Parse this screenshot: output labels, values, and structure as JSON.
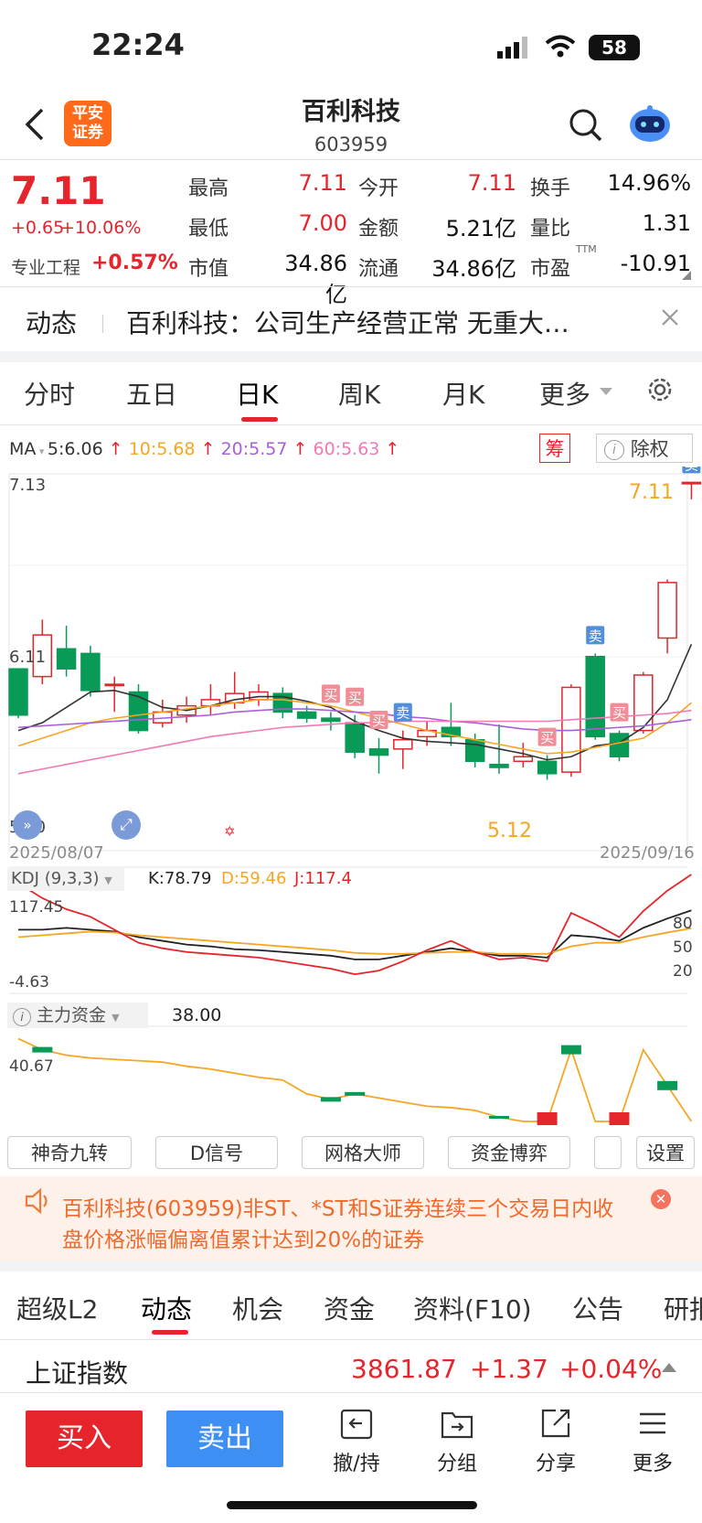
{
  "status_bar": {
    "time": "22:24",
    "battery": "58"
  },
  "header": {
    "broker_logo": "平安\n证券",
    "name": "百利科技",
    "code": "603959"
  },
  "quote": {
    "price": "7.11",
    "change": "+0.65",
    "change_pct": "+10.06%",
    "sector": "专业工程",
    "sector_pct": "+0.57%",
    "rows": [
      [
        {
          "label": "最高",
          "value": "7.11",
          "color": "red"
        },
        {
          "label": "今开",
          "value": "7.11",
          "color": "red"
        },
        {
          "label": "换手",
          "value": "14.96%",
          "color": "black"
        }
      ],
      [
        {
          "label": "最低",
          "value": "7.00",
          "color": "red"
        },
        {
          "label": "金额",
          "value": "5.21亿",
          "color": "black"
        },
        {
          "label": "量比",
          "value": "1.31",
          "color": "black"
        }
      ],
      [
        {
          "label": "市值",
          "value": "34.86亿",
          "color": "black"
        },
        {
          "label": "流通",
          "value": "34.86亿",
          "color": "black"
        },
        {
          "label": "市盈",
          "value": "-10.91",
          "color": "black"
        }
      ]
    ],
    "ttm": "TTM"
  },
  "news": {
    "tag": "动态",
    "text": "百利科技：公司生产经营正常 无重大…"
  },
  "period_tabs": [
    "分时",
    "五日",
    "日K",
    "周K",
    "月K",
    "更多"
  ],
  "active_period": "日K",
  "ma_legend": {
    "label": "MA",
    "ma5": "5:6.06",
    "ma10": "10:5.68",
    "ma20": "20:5.57",
    "ma60": "60:5.63",
    "chip": "筹",
    "adjust": "除权"
  },
  "chart_data": [
    {
      "type": "candlestick",
      "title": "",
      "ylim": [
        5.1,
        7.13
      ],
      "y_top_label": "7.13",
      "y_mid_label": "6.11",
      "y_bottom_label": "5.10",
      "x_start": "2025/08/07",
      "x_end": "2025/09/16",
      "high_label": "7.11",
      "low_label": "5.12",
      "candles": [
        {
          "o": 5.9,
          "c": 5.6,
          "h": 5.9,
          "l": 5.58
        },
        {
          "o": 5.85,
          "c": 6.12,
          "h": 6.22,
          "l": 5.8
        },
        {
          "o": 6.03,
          "c": 5.9,
          "h": 6.18,
          "l": 5.85
        },
        {
          "o": 6.0,
          "c": 5.76,
          "h": 6.05,
          "l": 5.72
        },
        {
          "o": 5.8,
          "c": 5.8,
          "h": 5.85,
          "l": 5.62
        },
        {
          "o": 5.75,
          "c": 5.5,
          "h": 5.8,
          "l": 5.48
        },
        {
          "o": 5.55,
          "c": 5.62,
          "h": 5.7,
          "l": 5.52
        },
        {
          "o": 5.6,
          "c": 5.66,
          "h": 5.72,
          "l": 5.55
        },
        {
          "o": 5.66,
          "c": 5.7,
          "h": 5.8,
          "l": 5.6
        },
        {
          "o": 5.68,
          "c": 5.74,
          "h": 5.88,
          "l": 5.64
        },
        {
          "o": 5.7,
          "c": 5.75,
          "h": 5.8,
          "l": 5.66
        },
        {
          "o": 5.74,
          "c": 5.62,
          "h": 5.78,
          "l": 5.58
        },
        {
          "o": 5.62,
          "c": 5.58,
          "h": 5.66,
          "l": 5.55
        },
        {
          "o": 5.58,
          "c": 5.56,
          "h": 5.62,
          "l": 5.5
        },
        {
          "o": 5.55,
          "c": 5.36,
          "h": 5.6,
          "l": 5.32
        },
        {
          "o": 5.38,
          "c": 5.34,
          "h": 5.45,
          "l": 5.22
        },
        {
          "o": 5.38,
          "c": 5.44,
          "h": 5.5,
          "l": 5.25
        },
        {
          "o": 5.46,
          "c": 5.5,
          "h": 5.56,
          "l": 5.4
        },
        {
          "o": 5.52,
          "c": 5.46,
          "h": 5.68,
          "l": 5.4
        },
        {
          "o": 5.44,
          "c": 5.3,
          "h": 5.48,
          "l": 5.26
        },
        {
          "o": 5.28,
          "c": 5.26,
          "h": 5.54,
          "l": 5.22
        },
        {
          "o": 5.3,
          "c": 5.33,
          "h": 5.42,
          "l": 5.26
        },
        {
          "o": 5.3,
          "c": 5.22,
          "h": 5.34,
          "l": 5.18
        },
        {
          "o": 5.23,
          "c": 5.78,
          "h": 5.8,
          "l": 5.2
        },
        {
          "o": 5.98,
          "c": 5.46,
          "h": 6.0,
          "l": 5.44
        },
        {
          "o": 5.48,
          "c": 5.33,
          "h": 5.5,
          "l": 5.3
        },
        {
          "o": 5.5,
          "c": 5.86,
          "h": 5.88,
          "l": 5.48
        },
        {
          "o": 6.1,
          "c": 6.46,
          "h": 6.48,
          "l": 6.0
        },
        {
          "o": 7.11,
          "c": 7.11,
          "h": 7.11,
          "l": 7.0
        }
      ],
      "ma_lines": {
        "ma5": [
          5.5,
          5.55,
          5.65,
          5.75,
          5.76,
          5.72,
          5.65,
          5.63,
          5.66,
          5.7,
          5.72,
          5.72,
          5.69,
          5.65,
          5.56,
          5.5,
          5.45,
          5.43,
          5.42,
          5.41,
          5.38,
          5.35,
          5.31,
          5.33,
          5.4,
          5.42,
          5.52,
          5.7,
          6.06
        ],
        "ma10": [
          5.4,
          5.45,
          5.5,
          5.55,
          5.58,
          5.6,
          5.62,
          5.64,
          5.66,
          5.68,
          5.7,
          5.7,
          5.68,
          5.66,
          5.62,
          5.58,
          5.54,
          5.5,
          5.47,
          5.44,
          5.41,
          5.38,
          5.35,
          5.36,
          5.39,
          5.42,
          5.45,
          5.55,
          5.68
        ],
        "ma20": [
          5.52,
          5.53,
          5.54,
          5.55,
          5.56,
          5.57,
          5.58,
          5.59,
          5.6,
          5.62,
          5.63,
          5.64,
          5.64,
          5.63,
          5.62,
          5.61,
          5.59,
          5.58,
          5.56,
          5.55,
          5.53,
          5.51,
          5.5,
          5.5,
          5.51,
          5.52,
          5.53,
          5.55,
          5.57
        ],
        "ma60": [
          5.22,
          5.25,
          5.28,
          5.31,
          5.34,
          5.37,
          5.4,
          5.43,
          5.46,
          5.48,
          5.5,
          5.52,
          5.53,
          5.54,
          5.55,
          5.55,
          5.56,
          5.56,
          5.56,
          5.56,
          5.56,
          5.56,
          5.56,
          5.57,
          5.58,
          5.59,
          5.6,
          5.61,
          5.63
        ]
      },
      "signals": [
        {
          "i": 13,
          "text": "买",
          "kind": "buy"
        },
        {
          "i": 14,
          "text": "买",
          "kind": "buy"
        },
        {
          "i": 15,
          "text": "买",
          "kind": "buy"
        },
        {
          "i": 16,
          "text": "卖",
          "kind": "sell"
        },
        {
          "i": 22,
          "text": "买",
          "kind": "buy"
        },
        {
          "i": 24,
          "text": "卖",
          "kind": "sell"
        },
        {
          "i": 25,
          "text": "买",
          "kind": "buy"
        },
        {
          "i": 28,
          "text": "卖",
          "kind": "sell"
        }
      ]
    },
    {
      "type": "line",
      "title": "KDJ (9,3,3)",
      "series_labels": {
        "k": "K:78.79",
        "d": "D:59.46",
        "j": "J:117.4"
      },
      "ylim": [
        -4.63,
        117.45
      ],
      "y_top_label": "117.45",
      "y_bottom_label": "-4.63",
      "ref_levels": [
        "80",
        "50",
        "20"
      ],
      "k": [
        58,
        58,
        60,
        58,
        56,
        50,
        46,
        42,
        40,
        37,
        36,
        34,
        32,
        30,
        26,
        26,
        30,
        34,
        38,
        34,
        30,
        30,
        28,
        52,
        50,
        46,
        60,
        70,
        78.79
      ],
      "d": [
        50,
        52,
        54,
        56,
        55,
        52,
        50,
        48,
        46,
        44,
        42,
        40,
        38,
        36,
        33,
        32,
        32,
        33,
        34,
        34,
        32,
        32,
        32,
        40,
        44,
        44,
        50,
        55,
        59.46
      ],
      "j": [
        108,
        92,
        80,
        72,
        58,
        44,
        38,
        34,
        32,
        30,
        28,
        24,
        20,
        16,
        10,
        14,
        24,
        36,
        46,
        34,
        26,
        28,
        24,
        76,
        64,
        50,
        78,
        100,
        117.4
      ]
    },
    {
      "type": "bar_line",
      "title": "主力资金",
      "value_label": "38.00",
      "left_label": "40.67",
      "line": [
        60,
        52,
        48,
        46,
        45,
        44,
        43,
        40,
        38,
        35,
        32,
        30,
        20,
        16,
        20,
        17,
        14,
        11,
        10,
        8,
        3,
        0,
        0,
        52,
        0,
        0,
        52,
        26,
        0
      ],
      "bars": [
        {
          "i": 1,
          "v": 6,
          "c": "green"
        },
        {
          "i": 13,
          "v": 5,
          "c": "green"
        },
        {
          "i": 14,
          "v": 4,
          "c": "green"
        },
        {
          "i": 20,
          "v": 3,
          "c": "green"
        },
        {
          "i": 22,
          "v": 20,
          "c": "red"
        },
        {
          "i": 23,
          "v": 10,
          "c": "green"
        },
        {
          "i": 25,
          "v": 20,
          "c": "red"
        },
        {
          "i": 27,
          "v": 10,
          "c": "green"
        }
      ]
    }
  ],
  "tools": [
    "神奇九转",
    "D信号",
    "网格大师",
    "资金博弈",
    "",
    "设置"
  ],
  "alert": {
    "text_line1": "百利科技(603959)非ST、*ST和S证券连续三个交易日内收",
    "text_line2": "盘价格涨幅偏离值累计达到20%的证券"
  },
  "bottom_tabs": [
    "超级L2",
    "动态",
    "机会",
    "资金",
    "资料(F10)",
    "公告",
    "研报"
  ],
  "active_bottom_tab": "动态",
  "index": {
    "name": "上证指数",
    "value": "3861.87",
    "change": "+1.37",
    "pct": "+0.04%"
  },
  "actions": {
    "buy": "买入",
    "sell": "卖出",
    "hold": "撤/持",
    "group": "分组",
    "share": "分享",
    "more": "更多"
  },
  "colors": {
    "up": "#e5242b",
    "down": "#0a9a58",
    "ma5": "#333333",
    "ma10": "#f5a623",
    "ma20": "#a85fd8",
    "ma60": "#f07ab4",
    "buy_btn": "#e5242b",
    "sell_btn": "#3d8ff3"
  }
}
